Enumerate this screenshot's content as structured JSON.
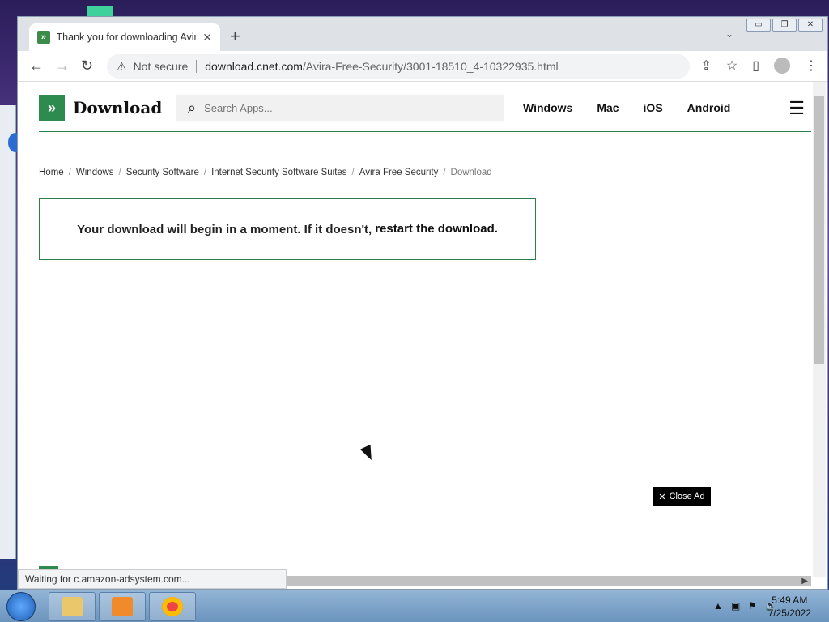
{
  "browser": {
    "tab_title": "Thank you for downloading Avira Free Security",
    "tab_close": "✕",
    "new_tab": "+",
    "tabs_menu": "⌄",
    "window_controls": {
      "minimize": "▭",
      "restore": "❐",
      "close": "✕"
    },
    "nav": {
      "back": "←",
      "forward": "→",
      "reload": "↻"
    },
    "security_icon": "⚠",
    "security_text": "Not secure",
    "url_host": "download.cnet.com",
    "url_path": "/Avira-Free-Security/3001-18510_4-10322935.html",
    "status_text": "Waiting for c.amazon-adsystem.com..."
  },
  "site": {
    "logo_text": "Download",
    "logo_mark": "»",
    "search_placeholder": "Search Apps...",
    "platforms": [
      "Windows",
      "Mac",
      "iOS",
      "Android"
    ]
  },
  "breadcrumb": [
    "Home",
    "Windows",
    "Security Software",
    "Internet Security Software Suites",
    "Avira Free Security",
    "Download"
  ],
  "notice": {
    "text": "Your download will begin in a moment. If it doesn't,",
    "link": "restart the download."
  },
  "ad": {
    "close_label": "Close Ad"
  },
  "taskbar": {
    "time": "5:49 AM",
    "date": "7/25/2022"
  },
  "colors": {
    "brand_green": "#2e8b4f"
  }
}
